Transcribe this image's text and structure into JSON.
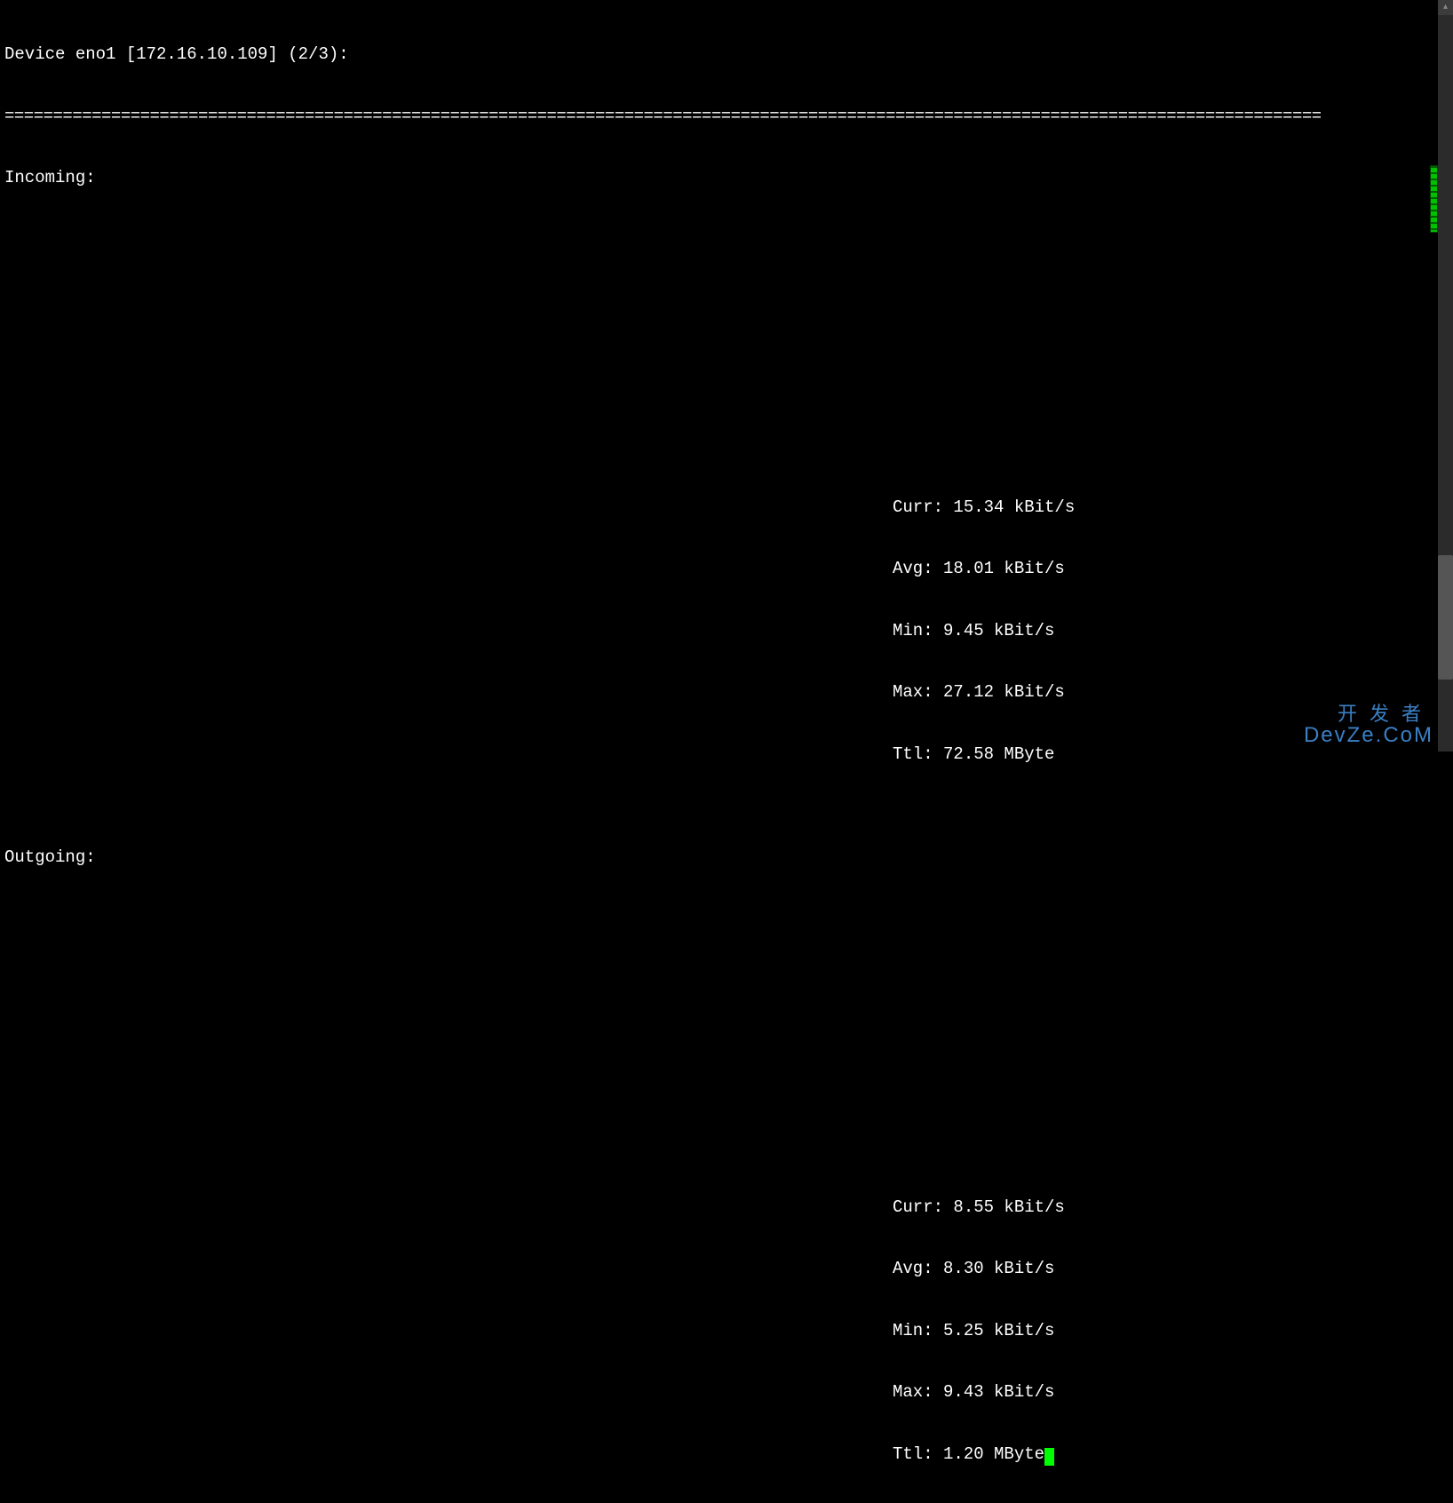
{
  "header": "Device eno1 [172.16.10.109] (2/3):",
  "divider": "================================================================================================================================================================================================================================================",
  "incoming": {
    "label": "Incoming:",
    "stats": {
      "curr": "Curr: 15.34 kBit/s",
      "avg": "Avg: 18.01 kBit/s",
      "min": "Min: 9.45 kBit/s",
      "max": "Max: 27.12 kBit/s",
      "ttl": "Ttl: 72.58 MByte"
    }
  },
  "outgoing": {
    "label": "Outgoing:",
    "stats": {
      "curr": "Curr: 8.55 kBit/s",
      "avg": "Avg: 8.30 kBit/s",
      "min": "Min: 5.25 kBit/s",
      "max": "Max: 9.43 kBit/s",
      "ttl": "Ttl: 1.20 MByte"
    }
  },
  "watermark": {
    "top": "开发者",
    "bottom": "DevZe.CoM"
  }
}
